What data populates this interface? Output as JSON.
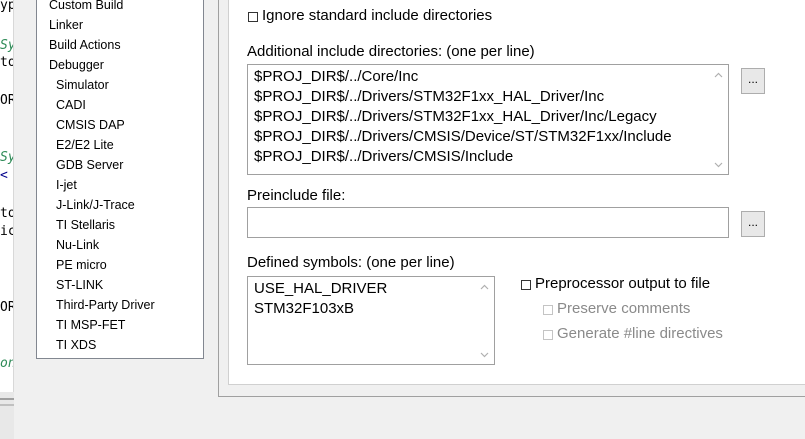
{
  "editor": {
    "lines": [
      {
        "text": "ype",
        "color": "#000000"
      },
      {
        "text": "Sy",
        "color": "#2e8b57"
      },
      {
        "text": "tor",
        "color": "#000000"
      },
      {
        "text": "OR;",
        "color": "#000000"
      },
      {
        "text": "Sy",
        "color": "#2e8b57"
      },
      {
        "text": "<",
        "color": "#00008b"
      },
      {
        "text": "tor",
        "color": "#000000"
      },
      {
        "text": "ick",
        "color": "#000000"
      },
      {
        "text": "OR;",
        "color": "#000000"
      },
      {
        "text": "on",
        "color": "#2e8b57"
      }
    ]
  },
  "category_list": {
    "items": [
      {
        "label": "Custom Build",
        "level": 0
      },
      {
        "label": "Linker",
        "level": 0
      },
      {
        "label": "Build Actions",
        "level": 0
      },
      {
        "label": "Debugger",
        "level": 0
      },
      {
        "label": "Simulator",
        "level": 1
      },
      {
        "label": "CADI",
        "level": 1
      },
      {
        "label": "CMSIS DAP",
        "level": 1
      },
      {
        "label": "E2/E2 Lite",
        "level": 1
      },
      {
        "label": "GDB Server",
        "level": 1
      },
      {
        "label": "I-jet",
        "level": 1
      },
      {
        "label": "J-Link/J-Trace",
        "level": 1
      },
      {
        "label": "TI Stellaris",
        "level": 1
      },
      {
        "label": "Nu-Link",
        "level": 1
      },
      {
        "label": "PE micro",
        "level": 1
      },
      {
        "label": "ST-LINK",
        "level": 1
      },
      {
        "label": "Third-Party Driver",
        "level": 1
      },
      {
        "label": "TI MSP-FET",
        "level": 1
      },
      {
        "label": "TI XDS",
        "level": 1
      }
    ]
  },
  "options": {
    "ignore_std_includes_label": "Ignore standard include directories",
    "include_dirs_label": "Additional include directories: (one per line)",
    "include_dirs": [
      "$PROJ_DIR$/../Core/Inc",
      "$PROJ_DIR$/../Drivers/STM32F1xx_HAL_Driver/Inc",
      "$PROJ_DIR$/../Drivers/STM32F1xx_HAL_Driver/Inc/Legacy",
      "$PROJ_DIR$/../Drivers/CMSIS/Device/ST/STM32F1xx/Include",
      "$PROJ_DIR$/../Drivers/CMSIS/Include"
    ],
    "browse_label": "...",
    "preinclude_label": "Preinclude file:",
    "preinclude_value": "",
    "defined_symbols_label": "Defined symbols: (one per line)",
    "defined_symbols": [
      "USE_HAL_DRIVER",
      "STM32F103xB"
    ],
    "preproc_output_label": "Preprocessor output to file",
    "preserve_comments_label": "Preserve comments",
    "generate_line_label": "Generate #line directives"
  },
  "icons": {
    "scroll_up": "chevron-up-icon",
    "scroll_down": "chevron-down-icon"
  }
}
